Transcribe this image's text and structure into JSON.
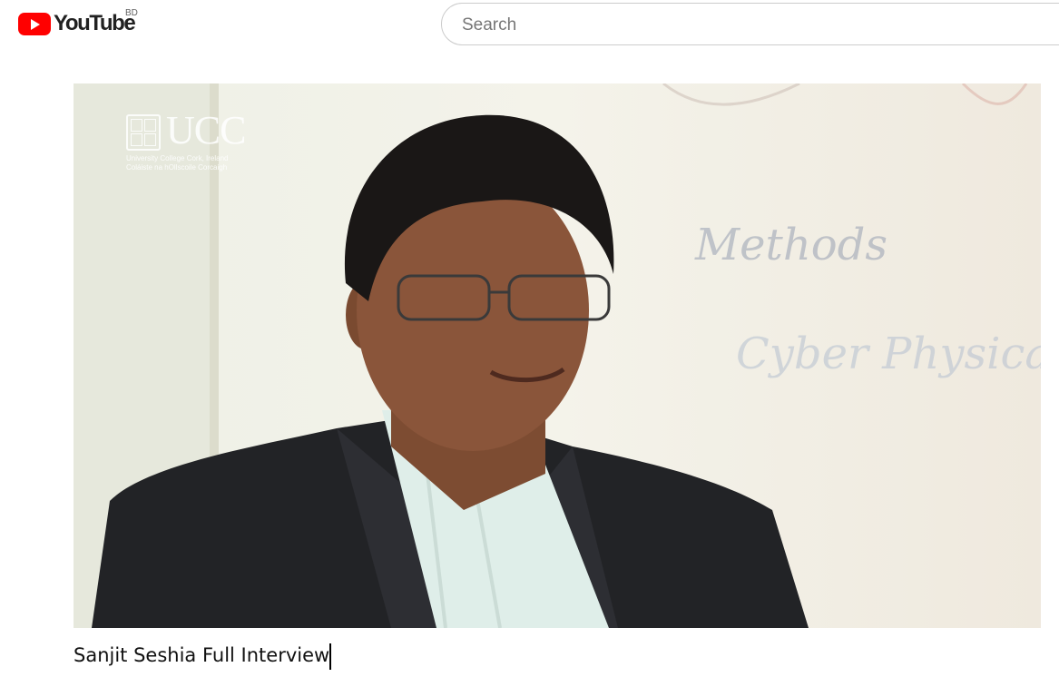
{
  "header": {
    "logo_text": "YouTube",
    "country_code": "BD",
    "search_placeholder": "Search"
  },
  "video": {
    "watermark": {
      "title": "UCC",
      "line1": "University College Cork, Ireland",
      "line2": "Coláiste na hOllscoile Corcaigh"
    },
    "whiteboard_text": [
      "Methods",
      "Cyber Physical Systems"
    ]
  },
  "page": {
    "video_title": "Sanjit Seshia Full Interview"
  },
  "colors": {
    "brand_red": "#ff0000",
    "text": "#111111"
  }
}
